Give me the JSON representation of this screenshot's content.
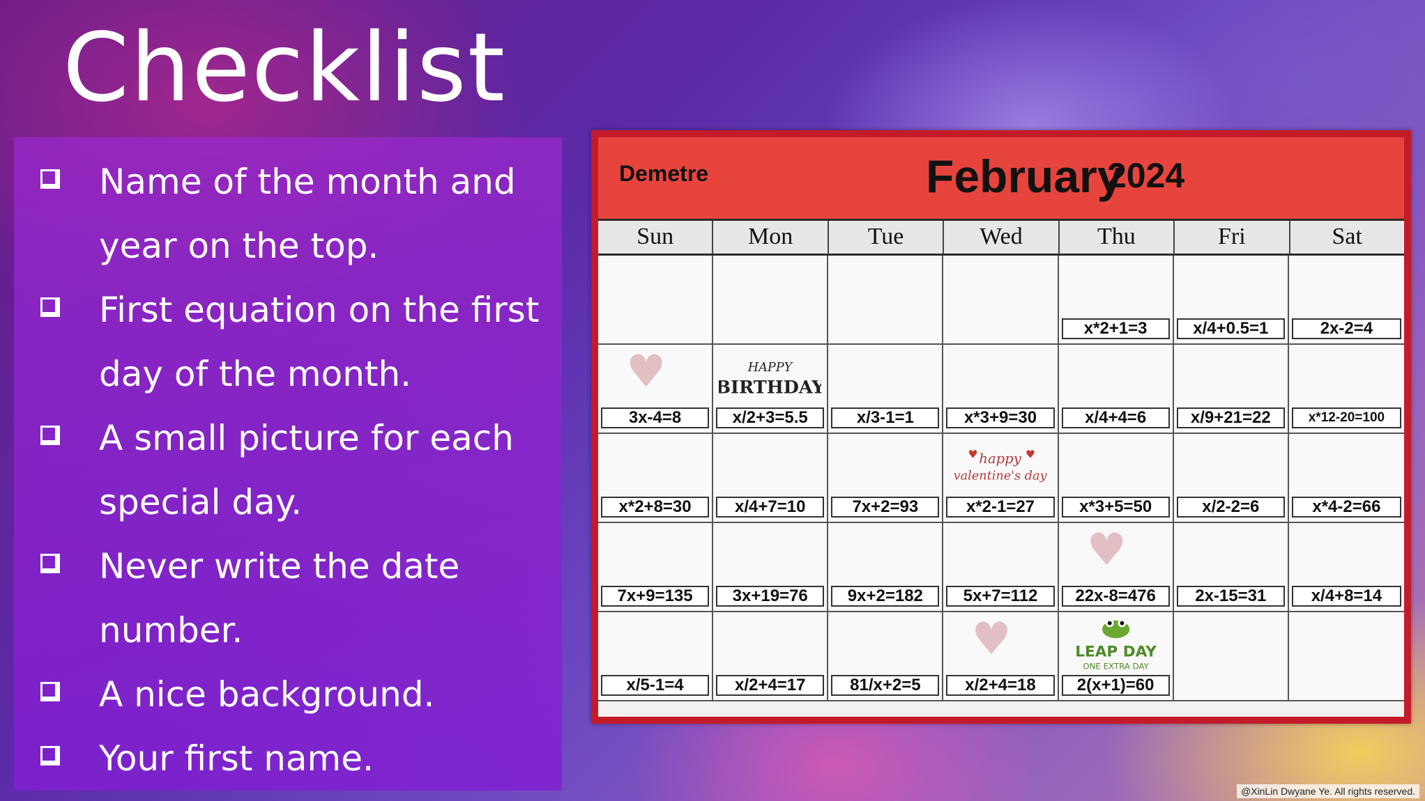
{
  "title": "Checklist",
  "checklist": [
    {
      "line1": "Name of the month and",
      "line2": "year on the top."
    },
    {
      "line1": "First equation on the first",
      "line2": "day of the month."
    },
    {
      "line1": "A small picture for each",
      "line2": "special day."
    },
    {
      "line1": "Never write the date",
      "line2": "number."
    },
    {
      "line1": "A nice background.",
      "line2": ""
    },
    {
      "line1": "Your first name.",
      "line2": ""
    }
  ],
  "calendar": {
    "name": "Demetre",
    "month": "February",
    "year": "2024",
    "days": [
      "Sun",
      "Mon",
      "Tue",
      "Wed",
      "Thu",
      "Fri",
      "Sat"
    ],
    "weeks": [
      [
        "",
        "",
        "",
        "",
        "x*2+1=3",
        "x/4+0.5=1",
        "2x-2=4"
      ],
      [
        "3x-4=8",
        "x/2+3=5.5",
        "x/3-1=1",
        "x*3+9=30",
        "x/4+4=6",
        "x/9+21=22",
        "x*12-20=100"
      ],
      [
        "x*2+8=30",
        "x/4+7=10",
        "7x+2=93",
        "x*2-1=27",
        "x*3+5=50",
        "x/2-2=6",
        "x*4-2=66"
      ],
      [
        "7x+9=135",
        "3x+19=76",
        "9x+2=182",
        "5x+7=112",
        "22x-8=476",
        "2x-15=31",
        "x/4+8=14"
      ],
      [
        "x/5-1=4",
        "x/2+4=17",
        "81/x+2=5",
        "x/2+4=18",
        "2(x+1)=60",
        "",
        ""
      ]
    ],
    "stickers": {
      "birthday": {
        "line1": "HAPPY",
        "line2": "BIRTHDAY"
      },
      "valentine": {
        "line1": "happy",
        "line2": "valentine's day"
      },
      "leap": {
        "line1": "LEAP DAY",
        "line2": "ONE EXTRA DAY"
      }
    }
  },
  "footer": "@XinLin Dwyane Ye. All rights reserved.",
  "colors": {
    "header": "#e8443e",
    "frame": "#c41b2a",
    "panel": "#8f25cf"
  }
}
